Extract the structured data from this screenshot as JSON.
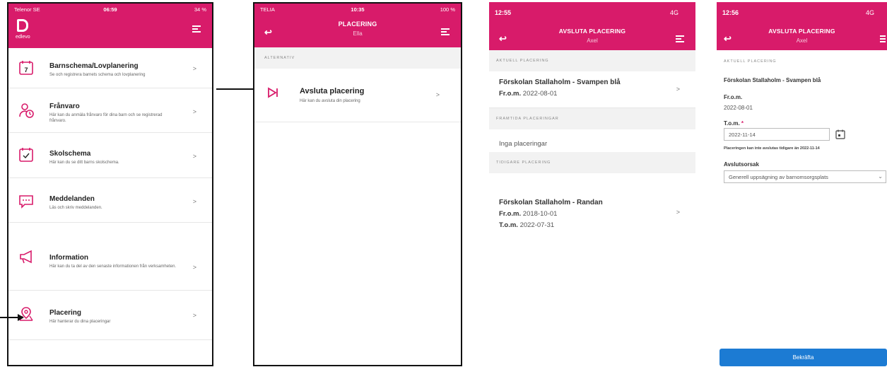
{
  "colors": {
    "brand": "#d81b6a",
    "accent_button": "#1c7bd3"
  },
  "p1": {
    "status": {
      "carrier": "Telenor SE",
      "time": "06:59",
      "battery": "34 %"
    },
    "logo_text": "edlevo",
    "items": [
      {
        "icon": "calendar-icon",
        "title": "Barnschema/Lovplanering",
        "desc": "Se och registrera barnets schema och lovplanering"
      },
      {
        "icon": "absence-icon",
        "title": "Frånvaro",
        "desc": "Här kan du anmäla frånvaro för dina barn och se registrerad frånvaro."
      },
      {
        "icon": "school-schedule-icon",
        "title": "Skolschema",
        "desc": "Här kan du se ditt barns skolschema."
      },
      {
        "icon": "message-icon",
        "title": "Meddelanden",
        "desc": "Läs och skriv meddelanden."
      },
      {
        "icon": "megaphone-icon",
        "title": "Information",
        "desc": "Här kan du ta del av den senaste informationen från verksamheten."
      },
      {
        "icon": "placement-icon",
        "title": "Placering",
        "desc": "Här hanterar du dina placeringar"
      }
    ]
  },
  "p2": {
    "status": {
      "carrier": "TELIA",
      "time": "10:35",
      "battery": "100 %"
    },
    "title": "PLACERING",
    "subtitle": "Ella",
    "section": "ALTERNATIV",
    "item": {
      "title": "Avsluta placering",
      "desc": "Här kan du avsluta din placering"
    }
  },
  "p3": {
    "status": {
      "time": "12:55",
      "signal": "4G"
    },
    "title": "AVSLUTA PLACERING",
    "subtitle": "Axel",
    "sec1": "AKTUELL PLACERING",
    "current": {
      "name": "Förskolan Stallaholm - Svampen blå",
      "from_label": "Fr.o.m.",
      "from": "2022-08-01"
    },
    "sec2": "FRAMTIDA PLACERINGAR",
    "none": "Inga placeringar",
    "sec3": "TIDIGARE PLACERING",
    "previous": {
      "name": "Förskolan Stallaholm - Randan",
      "from_label": "Fr.o.m.",
      "from": "2018-10-01",
      "to_label": "T.o.m.",
      "to": "2022-07-31"
    }
  },
  "p4": {
    "status": {
      "time": "12:56",
      "signal": "4G"
    },
    "title": "AVSLUTA PLACERING",
    "subtitle": "Axel",
    "sec1": "AKTUELL PLACERING",
    "name": "Förskolan Stallaholm - Svampen blå",
    "from_label": "Fr.o.m.",
    "from": "2022-08-01",
    "to_label": "T.o.m.",
    "required": "*",
    "to_value": "2022-11-14",
    "hint": "Placeringen kan inte avslutas tidigare än 2022-11-14",
    "reason_label": "Avslutsorsak",
    "reason_value": "Generell uppsägning av barnomsorgsplats",
    "confirm": "Bekräfta"
  }
}
